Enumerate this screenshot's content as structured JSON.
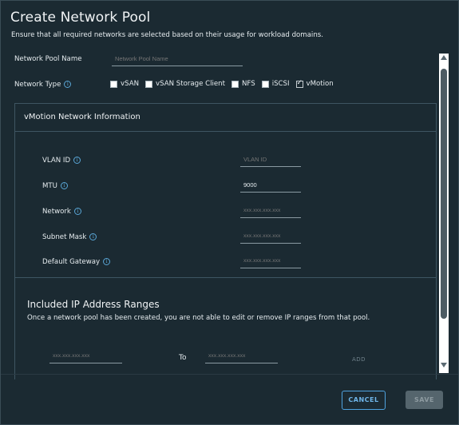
{
  "dialog": {
    "title": "Create Network Pool",
    "subtitle": "Ensure that all required networks are selected based on their usage for workload domains."
  },
  "pool_name": {
    "label": "Network Pool Name",
    "placeholder": "Network Pool Name"
  },
  "network_type": {
    "label": "Network Type",
    "options": [
      {
        "label": "vSAN",
        "checked": false
      },
      {
        "label": "vSAN Storage Client",
        "checked": false
      },
      {
        "label": "NFS",
        "checked": false
      },
      {
        "label": "iSCSI",
        "checked": false
      },
      {
        "label": "vMotion",
        "checked": true
      }
    ]
  },
  "vmotion": {
    "title": "vMotion Network Information",
    "vlan": {
      "label": "VLAN ID",
      "placeholder": "VLAN ID"
    },
    "mtu": {
      "label": "MTU",
      "value": "9000"
    },
    "network": {
      "label": "Network",
      "placeholder": "xxx.xxx.xxx.xxx"
    },
    "subnet": {
      "label": "Subnet Mask",
      "placeholder": "xxx.xxx.xxx.xxx"
    },
    "gateway": {
      "label": "Default Gateway",
      "placeholder": "xxx.xxx.xxx.xxx"
    }
  },
  "ip_ranges": {
    "title": "Included IP Address Ranges",
    "description": "Once a network pool has been created, you are not able to edit or remove IP ranges from that pool.",
    "from_placeholder": "xxx.xxx.xxx.xxx",
    "to_label": "To",
    "to_placeholder": "xxx.xxx.xxx.xxx",
    "add_label": "ADD"
  },
  "footer": {
    "cancel_label": "CANCEL",
    "save_label": "SAVE"
  },
  "colors": {
    "background": "#1b2a32",
    "accent": "#4fa3e0",
    "disabled_button": "#55656d"
  }
}
